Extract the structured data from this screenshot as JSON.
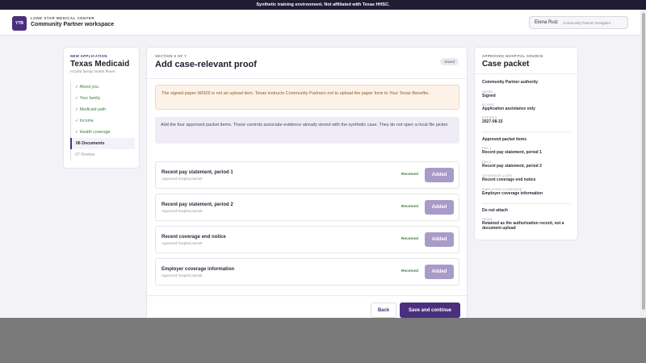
{
  "banner": "Synthetic training environment. Not affiliated with Texas HHSC.",
  "header": {
    "logo": "YTB",
    "org": "LONE STAR MEDICAL CENTER",
    "workspace": "Community Partner workspace",
    "user_name": "Elena Ruiz",
    "user_role": "Community Partner Navigator"
  },
  "left": {
    "eyebrow": "NEW APPLICATION",
    "title": "Texas Medicaid",
    "subtitle": "H1205 family health flexer",
    "steps": [
      {
        "label": "✓ About you",
        "state": "done"
      },
      {
        "label": "✓ Your family",
        "state": "done"
      },
      {
        "label": "✓ Medicaid path",
        "state": "done"
      },
      {
        "label": "✓ Income",
        "state": "done"
      },
      {
        "label": "✓ Health coverage",
        "state": "done"
      },
      {
        "label": "06 Documents",
        "state": "current"
      },
      {
        "label": "07 Review",
        "state": "todo"
      }
    ]
  },
  "main": {
    "section": "SECTION 6 OF 7",
    "title": "Add case-relevant proof",
    "saved": "Saved",
    "warning": "The signed paper H0926 is not an upload item. Texas instructs Community Partners not to upload the paper form to Your Texas Benefits.",
    "info": "Add the four approved packet items. These controls associate evidence already stored with the synthetic case. They do not open a local file picker.",
    "items": [
      {
        "name": "Recent pay statement, period 1",
        "source": "Approved hospital packet",
        "status": "Received",
        "button": "Added"
      },
      {
        "name": "Recent pay statement, period 2",
        "source": "Approved hospital packet",
        "status": "Received",
        "button": "Added"
      },
      {
        "name": "Recent coverage end notice",
        "source": "Approved hospital packet",
        "status": "Received",
        "button": "Added"
      },
      {
        "name": "Employer coverage information",
        "source": "Approved hospital packet",
        "status": "Received",
        "button": "Added"
      }
    ],
    "back": "Back",
    "next": "Save and continue"
  },
  "right": {
    "eyebrow": "APPROVED HOSPITAL SOURCE",
    "title": "Case packet",
    "auth_heading": "Community Partner authority",
    "auth": [
      {
        "key": "H0926",
        "value": "Signed"
      },
      {
        "key": "SCOPE",
        "value": "Application assistance only"
      },
      {
        "key": "EXPIRES",
        "value": "2027-08-15"
      }
    ],
    "packet_heading": "Approved packet items",
    "packet": [
      {
        "key": "PAY-1",
        "value": "Recent pay statement, period 1"
      },
      {
        "key": "PAY-2",
        "value": "Recent pay statement, period 2"
      },
      {
        "key": "COVERAGE-LOSS",
        "value": "Recent coverage end notice"
      },
      {
        "key": "EMPLOYER-COVERAGE",
        "value": "Employer coverage information"
      }
    ],
    "noattach_heading": "Do not attach",
    "noattach": [
      {
        "key": "H0926",
        "value": "Retained as the authorization record, not a document upload"
      }
    ]
  }
}
